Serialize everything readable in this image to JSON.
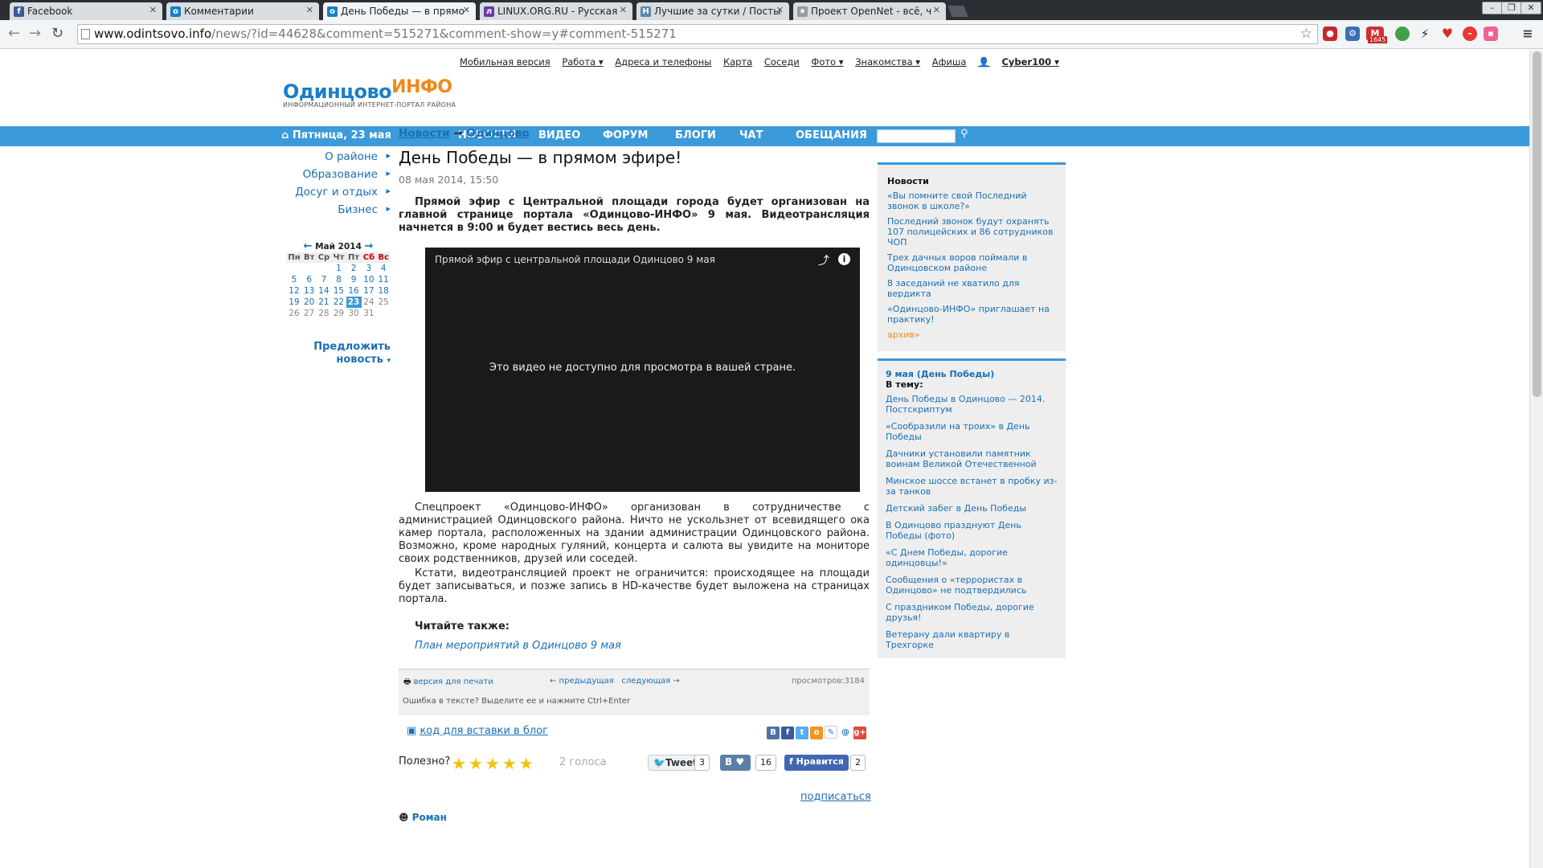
{
  "browser": {
    "tabs": [
      {
        "label": "Facebook",
        "icon": "facebook-icon",
        "color": "#3b5998",
        "glyph": "f"
      },
      {
        "label": "Комментарии",
        "icon": "odintsovo-icon",
        "color": "#1a7ec8",
        "glyph": "o"
      },
      {
        "label": "День Победы — в прямо",
        "icon": "odintsovo-icon",
        "color": "#1a7ec8",
        "glyph": "o"
      },
      {
        "label": "LINUX.ORG.RU - Русская",
        "icon": "linux-org-icon",
        "color": "#6a3aa0",
        "glyph": "л"
      },
      {
        "label": "Лучшие за сутки / Посты",
        "icon": "habr-icon",
        "color": "#5a89a8",
        "glyph": "H"
      },
      {
        "label": "Проект OpenNet - всё, ч",
        "icon": "opennet-icon",
        "color": "#999999",
        "glyph": "★"
      }
    ],
    "url_host": "www.odintsovo.info",
    "url_path": "/news/?id=44628&comment=515271&comment-show=y#comment-515271",
    "ext_badge": "1645"
  },
  "topnav": [
    "Мобильная версия",
    "Работа ▾",
    "Адреса и телефоны",
    "Карта",
    "Соседи",
    "Фото ▾",
    "Знакомства ▾",
    "Афиша"
  ],
  "user": "Cyber100 ▾",
  "logo": {
    "main": "Одинцово",
    "accent": "ИНФО",
    "tagline": "ИНФОРМАЦИОННЫЙ ИНТЕРНЕТ-ПОРТАЛ РАЙОНА"
  },
  "bluebar": {
    "date": "Пятница, 23 мая",
    "nav": [
      "НОВОСТИ",
      "ВИДЕО",
      "ФОРУМ",
      "БЛОГИ",
      "ЧАТ",
      "ОБЕЩАНИЯ"
    ]
  },
  "leftmenu": [
    "О районе",
    "Образование",
    "Досуг и отдых",
    "Бизнес"
  ],
  "calendar": {
    "month": "Май 2014",
    "weekdays": [
      "Пн",
      "Вт",
      "Ср",
      "Чт",
      "Пт",
      "Сб",
      "Вс"
    ],
    "weeks": [
      [
        "",
        "",
        "",
        "1",
        "2",
        "3",
        "4"
      ],
      [
        "5",
        "6",
        "7",
        "8",
        "9",
        "10",
        "11"
      ],
      [
        "12",
        "13",
        "14",
        "15",
        "16",
        "17",
        "18"
      ],
      [
        "19",
        "20",
        "21",
        "22",
        "23",
        "24",
        "25"
      ],
      [
        "26",
        "27",
        "28",
        "29",
        "30",
        "31",
        ""
      ]
    ],
    "today": "23"
  },
  "suggest": "Предложить новость",
  "article": {
    "crumb1": "Новости",
    "crumb_sep": "→",
    "crumb2": "Одинцово",
    "title": "День Победы — в прямом эфире!",
    "date": "08 мая 2014, 15:50",
    "lead": "Прямой эфир с Центральной площади города будет организован на главной странице портала «Одинцово-ИНФО» 9 мая. Видеотрансляция начнется в 9:00 и будет вестись весь день.",
    "video_title": "Прямой эфир с центральной площади Одинцово 9 мая",
    "video_msg": "Это видео не доступно для просмотра в вашей стране.",
    "p1": "Спецпроект «Одинцово-ИНФО» организован в сотрудничестве с администрацией Одинцовского района. Ничто не ускользнет от всевидящего ока камер портала, расположенных на здании администрации Одинцовского района. Возможно, кроме народных гуляний, концерта и салюта вы увидите на мониторе своих родственников, друзей или соседей.",
    "p2": "Кстати, видеотрансляцией проект не ограничится: происходящее на площади будет записываться, и позже запись в HD-качестве будет выложена на страницах портала.",
    "read_also": "Читайте также:",
    "read_also_link": "План мероприятий в Одинцово 9 мая"
  },
  "toolbox": {
    "print": "версия для печати",
    "prev": "← предыдущая",
    "next": "следующая →",
    "views": "просмотров:3184",
    "error_hint": "Ошибка в тексте? Выделите ее и нажмите Ctrl+Enter"
  },
  "embed": "код для вставки в блог",
  "rating": {
    "label": "Полезно?",
    "stars": 5,
    "votes": "2 голоса",
    "tweet": "Tweet",
    "tweet_count": "3",
    "vk_count": "16",
    "fb_like": "Нравится",
    "fb_count": "2"
  },
  "subscribe": "подписаться",
  "comment_peek": "Роман",
  "sidebar_news": {
    "heading": "Новости",
    "items": [
      "«Вы помните свой Последний звонок в школе?»",
      "Последний звонок будут охранять 107 полицейских и 86 сотрудников ЧОП",
      "Трех дачных воров поймали в Одинцовском районе",
      "8 заседаний не хватило для вердикта",
      "«Одинцово-ИНФО» приглашает на практику!"
    ],
    "archive": "архив»"
  },
  "sidebar_topic": {
    "heading": "9 мая (День Победы)",
    "sub": "В тему:",
    "items": [
      "День Победы в Одинцово — 2014. Постскриптум",
      "«Сообразили на троих» в День Победы",
      "Дачники установили памятник воинам Великой Отечественной",
      "Минское шоссе встанет в пробку из-за танков",
      "Детский забег в День Победы",
      "В Одинцово празднуют День Победы (фото)",
      "«С Днем Победы, дорогие одинцовцы!»",
      "Сообщения о «террористах в Одинцово» не подтвердились",
      "С праздником Победы, дорогие друзья!",
      "Ветерану дали квартиру в Трехгорке"
    ]
  }
}
